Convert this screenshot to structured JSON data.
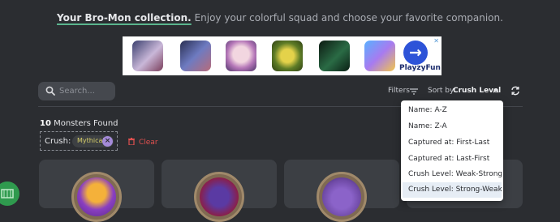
{
  "intro": {
    "highlight": "Your Bro-Mon collection.",
    "text": " Enjoy your colorful squad and choose your favorite companion."
  },
  "ad": {
    "brand_arrow": "→",
    "brand_name": "PlayzyFun",
    "close_glyph": "✕",
    "icons": [
      "anime-game-icon",
      "dragon-game-icon",
      "anime-girl-game-icon",
      "temple-run-icon",
      "fc-soccer-icon",
      "snake-game-icon"
    ]
  },
  "toolbar": {
    "search_placeholder": "Search...",
    "filters_label": "Filters",
    "sort_label": "Sort by:",
    "sort_value": "Crush Level"
  },
  "results": {
    "count": "10",
    "count_suffix": " Monsters Found"
  },
  "crush_filter": {
    "label": "Crush:",
    "chip": "Mythical",
    "chip_remove": "×",
    "clear_label": "Clear"
  },
  "sort_menu": {
    "options": [
      "Name: A-Z",
      "Name: Z-A",
      "Captured at: First-Last",
      "Captured at: Last-First",
      "Crush Level: Weak-Strong",
      "Crush Level: Strong-Weak"
    ],
    "selected_index": 5
  },
  "colors": {
    "background": "#2b2d31",
    "accent_underline": "#5ab58e",
    "clear_red": "#e0504f",
    "chip_text": "#d9d06a",
    "card": "#3c3f44"
  }
}
